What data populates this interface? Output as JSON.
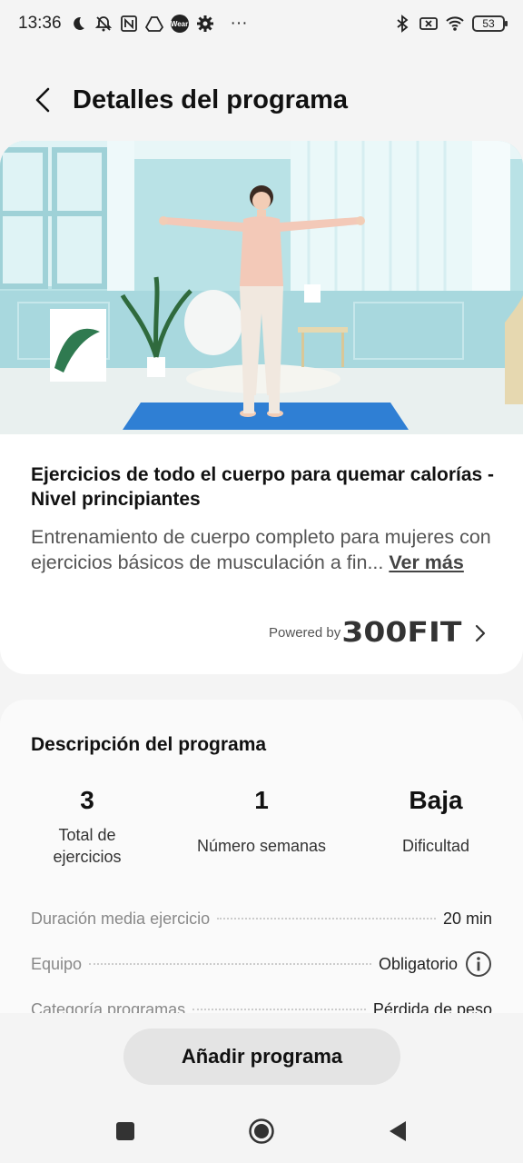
{
  "status_bar": {
    "time": "13:36",
    "battery": "53",
    "icons": [
      "moon-icon",
      "mute-icon",
      "nfc-icon",
      "drive-icon",
      "wear-icon",
      "settings-icon",
      "more-icon",
      "bluetooth-icon",
      "sim-off-icon",
      "wifi-icon",
      "battery-icon"
    ],
    "wear_label": "Wear",
    "more": "···"
  },
  "header": {
    "title": "Detalles del programa"
  },
  "program": {
    "name": "Ejercicios de todo el cuerpo para quemar calorías - Nivel principiantes",
    "description": "Entrenamiento de cuerpo completo para mujeres con ejercicios básicos de musculación a fin... ",
    "see_more": "Ver más",
    "powered_by": "Powered by",
    "brand": "300FIT"
  },
  "description_section": {
    "title": "Descripción del programa",
    "stats": [
      {
        "value": "3",
        "label": "Total de ejercicios"
      },
      {
        "value": "1",
        "label": "Número semanas"
      },
      {
        "value": "Baja",
        "label": "Dificultad"
      }
    ],
    "details": [
      {
        "label": "Duración media ejercicio",
        "value": "20 min"
      },
      {
        "label": "Equipo",
        "value": "Obligatorio"
      },
      {
        "label": "Categoría programas",
        "value": "Pérdida de peso"
      }
    ]
  },
  "actions": {
    "add_program": "Añadir programa"
  },
  "colors": {
    "background": "#f4f4f4",
    "card": "#ffffff",
    "button": "#e4e4e4",
    "hero_wall": "#b7e1e6",
    "mat": "#2f7fd4"
  }
}
